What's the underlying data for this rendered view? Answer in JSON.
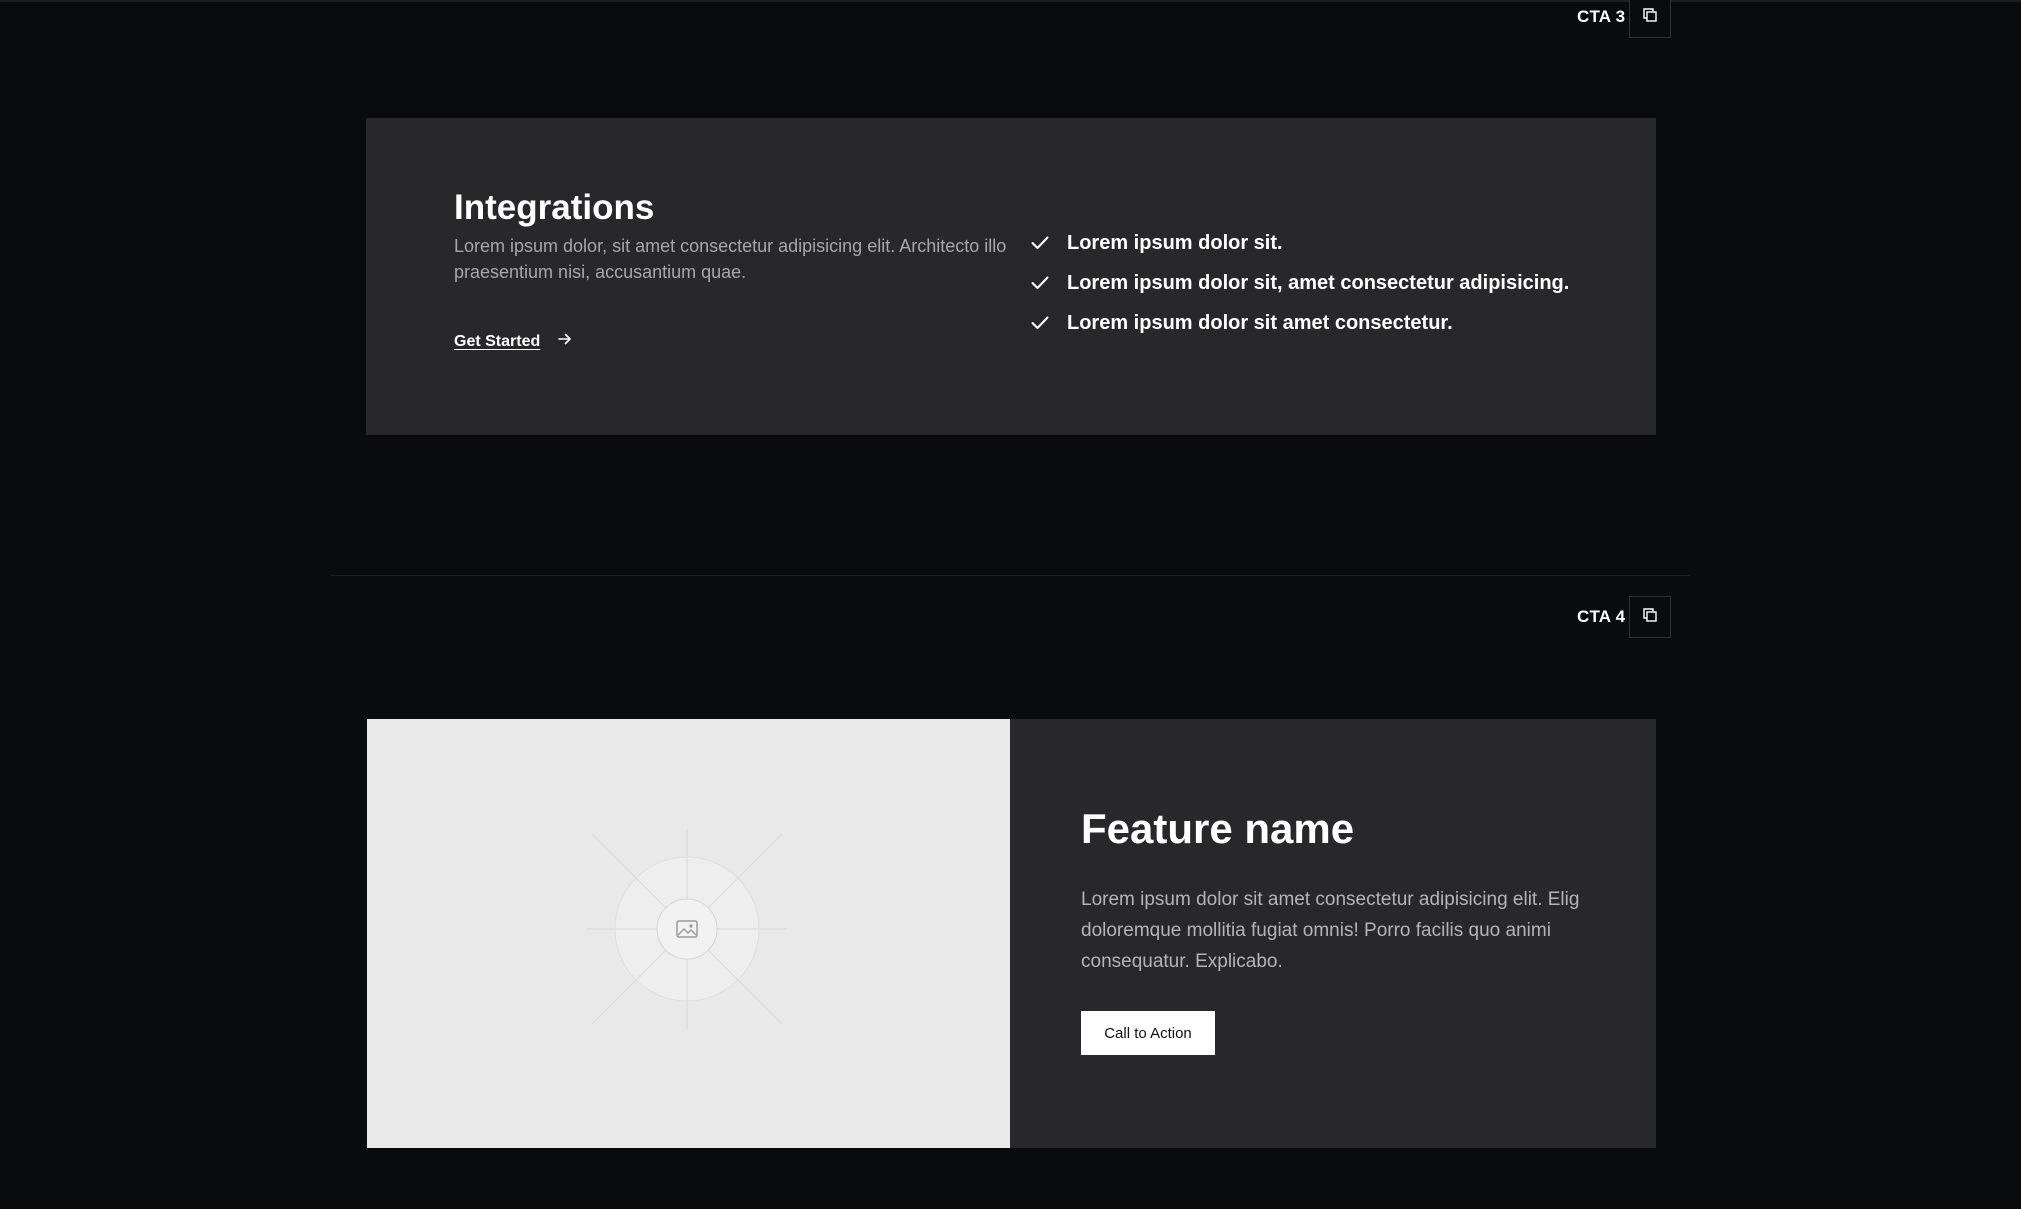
{
  "sections": [
    {
      "label": "CTA 3",
      "card": {
        "title": "Integrations",
        "description": "Lorem ipsum dolor, sit amet consectetur adipisicing elit. Architecto illo praesentium nisi, accusantium quae.",
        "link_label": "Get Started",
        "link_icon": "arrow-right-icon",
        "checklist": [
          "Lorem ipsum dolor sit.",
          "Lorem ipsum dolor sit, amet consectetur adipisicing.",
          "Lorem ipsum dolor sit amet consectetur."
        ],
        "check_icon": "check-icon"
      }
    },
    {
      "label": "CTA 4",
      "card": {
        "image_icon": "image-placeholder-icon",
        "title": "Feature name",
        "description": "Lorem ipsum dolor sit amet consectetur adipisicing elit. Elig doloremque mollitia fugiat omnis! Porro facilis quo animi consequatur. Explicabo.",
        "button_label": "Call to Action"
      }
    }
  ],
  "copy_icon": "copy-icon",
  "colors": {
    "background": "#0a0b0d",
    "card": "#28282a",
    "image_placeholder": "#e9e9e9",
    "muted_text": "#a7a7ab",
    "button_bg": "#ffffff"
  }
}
